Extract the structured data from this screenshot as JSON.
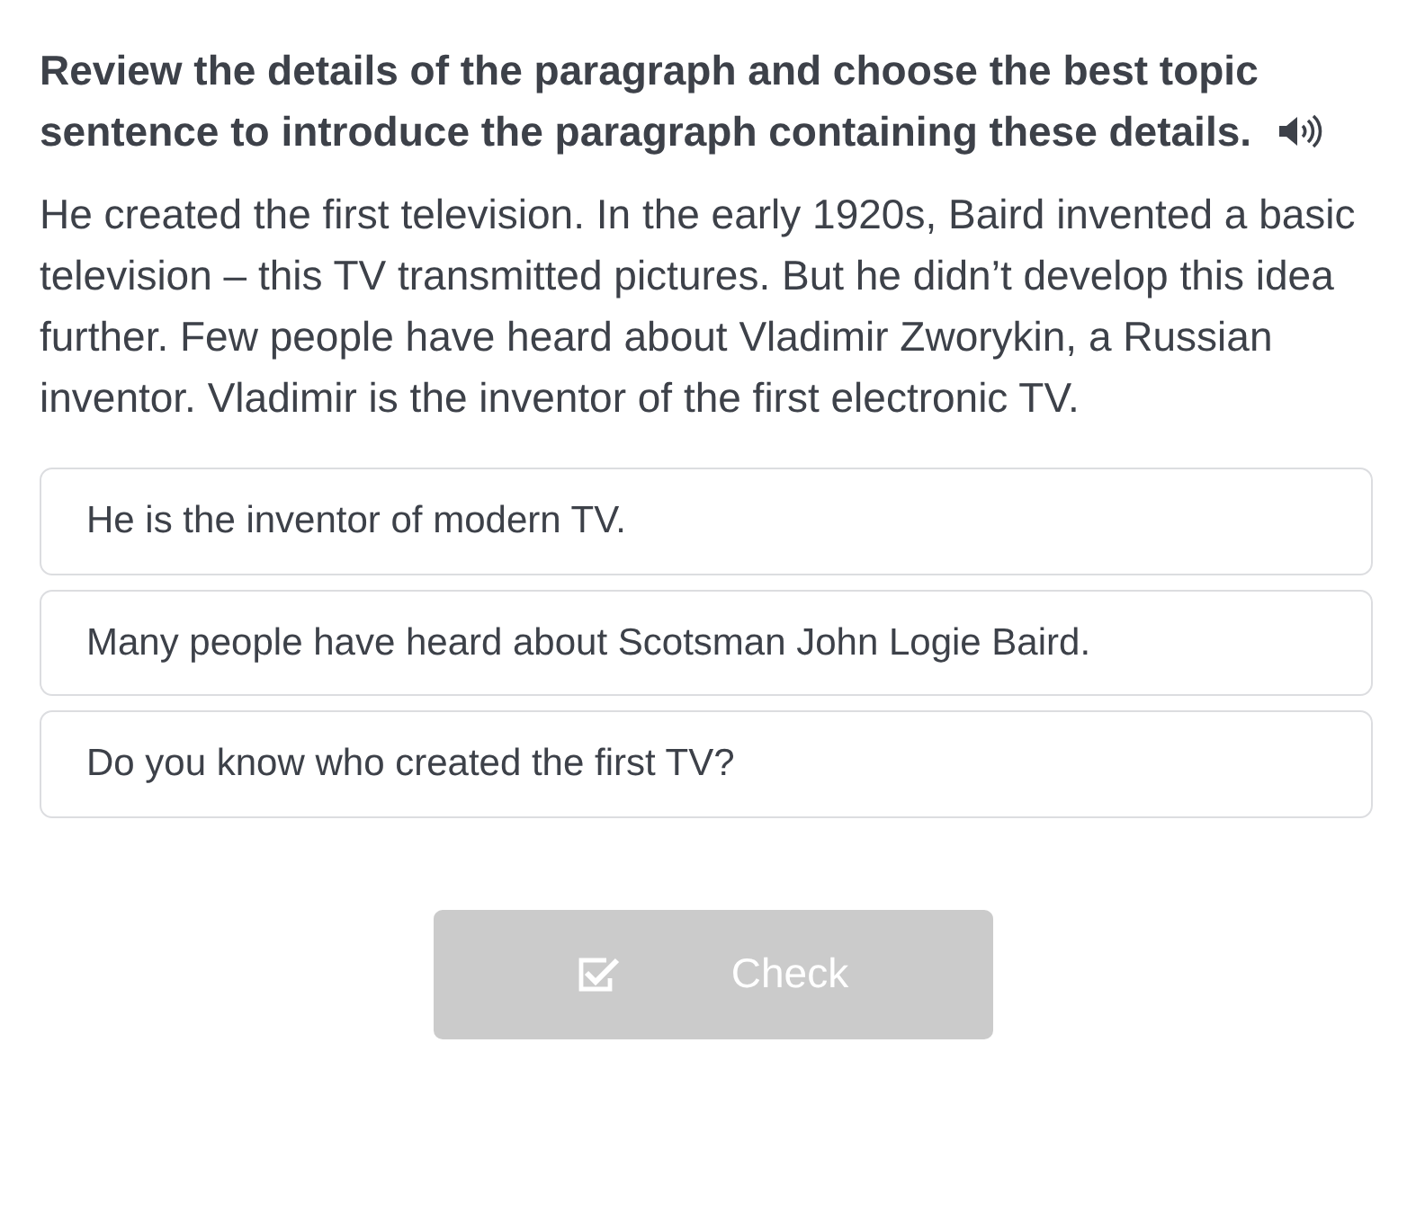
{
  "question": {
    "prompt": "Review the details of the paragraph and choose the best topic sentence to introduce the paragraph containing these details.",
    "passage": "He created the first television. In the early 1920s, Baird invented a basic television – this TV transmitted pictures. But he didn’t develop this idea further. Few people have heard about Vladimir Zworykin, a Russian inventor. Vladimir is the inventor of the first electronic TV."
  },
  "options": [
    {
      "label": "He is the inventor of modern TV.",
      "selected": false
    },
    {
      "label": "Many people have heard about Scotsman John Logie Baird.",
      "selected": false
    },
    {
      "label": "Do you know who created the first TV?",
      "selected": false
    }
  ],
  "check_button": {
    "label": "Check",
    "disabled": true
  }
}
